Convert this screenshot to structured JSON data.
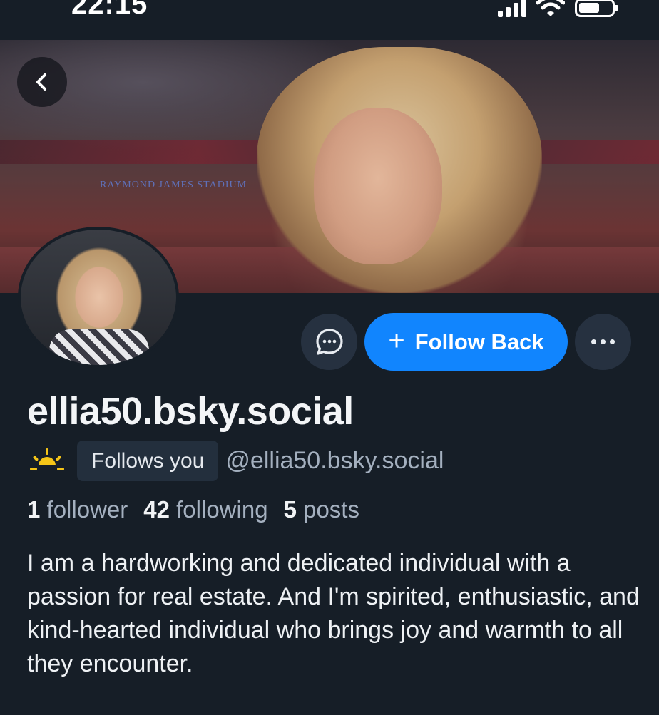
{
  "status_bar": {
    "time": "22:15"
  },
  "profile": {
    "display_name": "ellia50.bsky.social",
    "follows_you_label": "Follows you",
    "handle": "@ellia50.bsky.social",
    "stats": {
      "followers_count": "1",
      "followers_label": "follower",
      "following_count": "42",
      "following_label": "following",
      "posts_count": "5",
      "posts_label": "posts"
    },
    "bio": "I am a hardworking and dedicated individual with a passion for real estate. And I'm spirited, enthusiastic, and kind-hearted individual who brings joy and warmth to all they encounter."
  },
  "actions": {
    "follow_back_label": "Follow Back"
  },
  "banner": {
    "stadium_text": "RAYMOND JAMES STADIUM"
  },
  "icons": {
    "back": "chevron-left-icon",
    "message": "chat-bubble-icon",
    "more": "ellipsis-icon",
    "follow": "plus-icon",
    "moderation": "sunrise-icon"
  },
  "colors": {
    "background": "#161e27",
    "accent": "#1185fe",
    "chip": "#232f3d",
    "muted_text": "#a4b0bf",
    "moderation_icon": "#f5c518"
  }
}
